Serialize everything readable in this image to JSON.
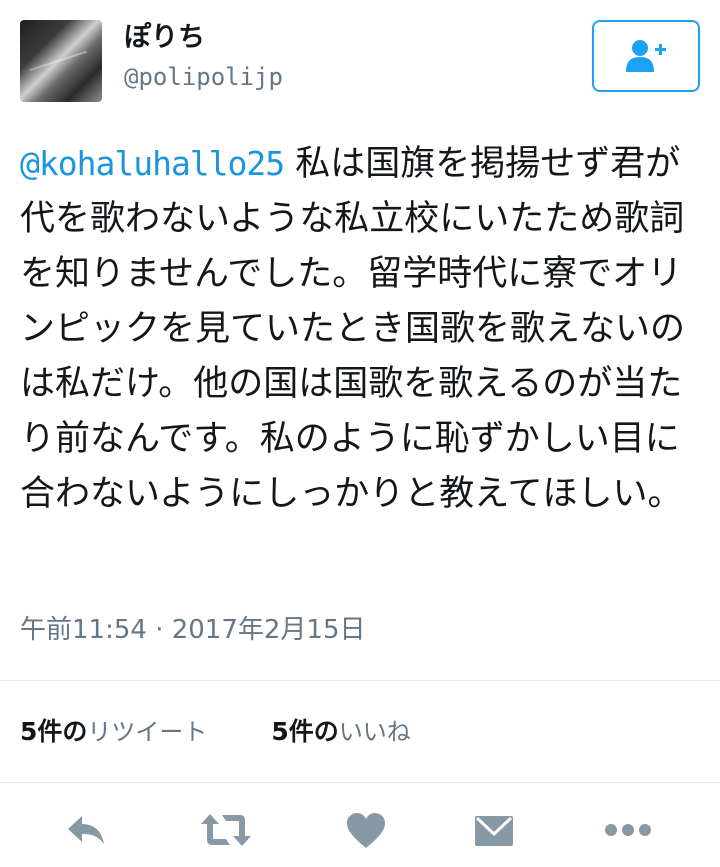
{
  "user": {
    "display_name": "ぽりち",
    "handle": "@polipolijp"
  },
  "tweet": {
    "mention": "@kohaluhallo25",
    "text": " 私は国旗を掲揚せず君が代を歌わないような私立校にいたため歌詞を知りませんでした。留学時代に寮でオリンピックを見ていたとき国歌を歌えないのは私だけ。他の国は国歌を歌えるのが当たり前なんです。私のように恥ずかしい目に合わないようにしっかりと教えてほしい。",
    "timestamp": "午前11:54 · 2017年2月15日"
  },
  "stats": {
    "retweets_count": "5件の",
    "retweets_label": "リツイート",
    "likes_count": "5件の",
    "likes_label": "いいね"
  },
  "icons": {
    "follow": "add-user-icon",
    "reply": "reply-arrow-icon",
    "retweet": "retweet-icon",
    "like": "heart-icon",
    "message": "envelope-icon",
    "more": "more-dots-icon"
  },
  "colors": {
    "accent": "#1da1f2",
    "mention": "#1b95e0",
    "text": "#14171a",
    "secondary": "#657786",
    "icon": "#8899a6",
    "divider": "#e1e8ed"
  }
}
